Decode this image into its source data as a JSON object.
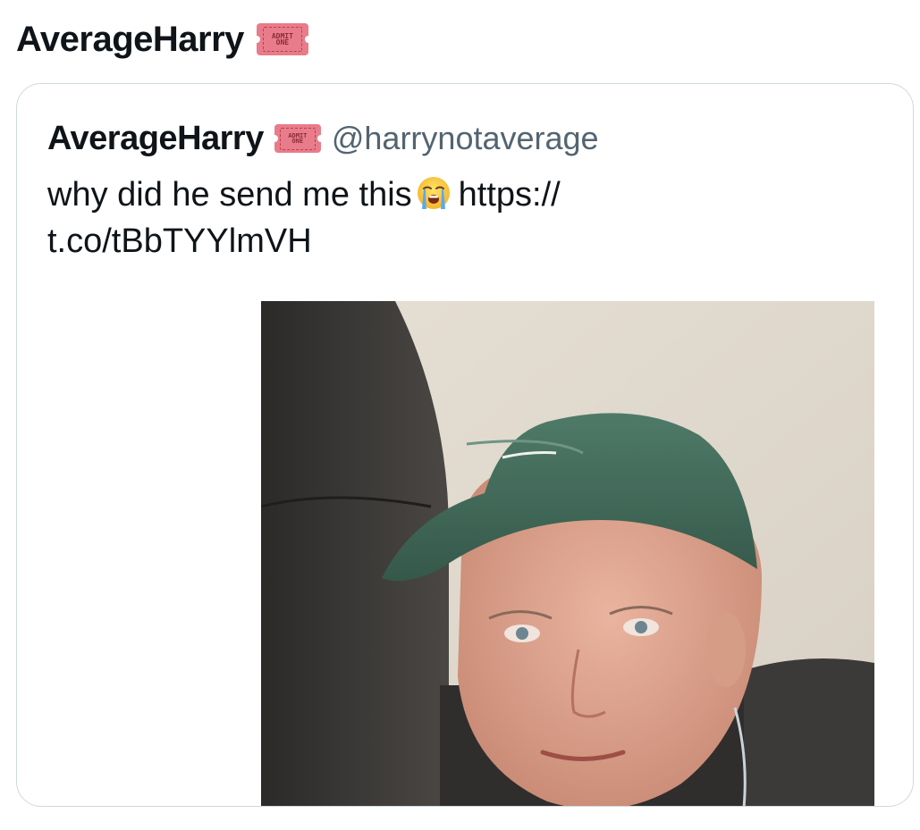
{
  "top": {
    "author_name": "AverageHarry",
    "badge_icon": "admit-one-ticket-icon",
    "badge_text_line1": "ADMIT",
    "badge_text_line2": "ONE"
  },
  "quoted_tweet": {
    "author_name": "AverageHarry",
    "badge_icon": "admit-one-ticket-icon",
    "badge_text_line1": "ADMIT",
    "badge_text_line2": "ONE",
    "handle": "@harrynotaverage",
    "text_line1": "why did he send me this",
    "emoji": "loudly-crying-face-icon",
    "link_part1": "https://",
    "text_line2": "t.co/tBbTYYlmVH",
    "media_icon": "selfie-photo"
  },
  "colors": {
    "text": "#0f1419",
    "handle": "#536471",
    "card_border": "#cfd9de",
    "ticket": "#e87c8a"
  }
}
